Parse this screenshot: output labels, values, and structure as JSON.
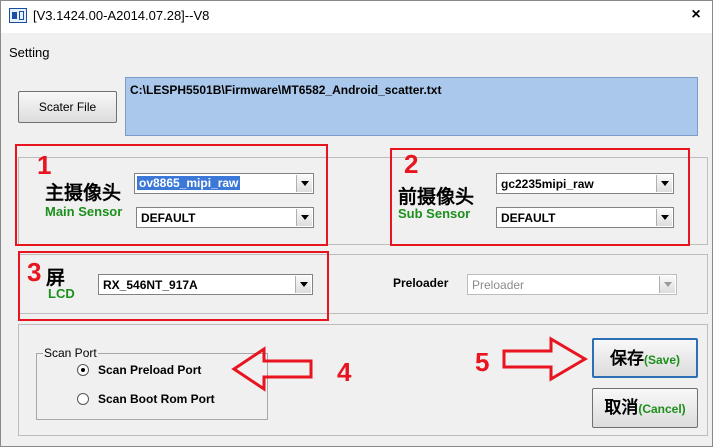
{
  "window": {
    "title": "[V3.1424.00-A2014.07.28]--V8",
    "close_glyph": "×",
    "app_icon": "app-icon"
  },
  "menu": {
    "setting": "Setting"
  },
  "scatter": {
    "button_label": "Scater File",
    "path": "C:\\LESPH5501B\\Firmware\\MT6582_Android_scatter.txt"
  },
  "main_camera": {
    "number": "1",
    "label_cn": "主摄像头",
    "label_en": "Main Sensor",
    "sensor_value": "ov8865_mipi_raw",
    "lens_value": "DEFAULT"
  },
  "sub_camera": {
    "number": "2",
    "label_cn": "前摄像头",
    "label_en": "Sub Sensor",
    "sensor_value": "gc2235mipi_raw",
    "lens_value": "DEFAULT"
  },
  "lcd": {
    "number": "3",
    "label_cn": "屏",
    "label_en": "LCD",
    "value": "RX_546NT_917A"
  },
  "preloader": {
    "label": "Preloader",
    "value": "Preloader"
  },
  "scan_port": {
    "title": "Scan Port",
    "options": [
      {
        "label": "Scan Preload Port",
        "checked": true
      },
      {
        "label": "Scan Boot Rom Port",
        "checked": false
      }
    ],
    "annotation_number": "4"
  },
  "actions": {
    "annotation_number": "5",
    "save_cn": "保存",
    "save_en": "(Save)",
    "cancel_cn": "取消",
    "cancel_en": "(Cancel)"
  },
  "colors": {
    "annotation_red": "#e8141f",
    "sensor_green": "#1c8f1c",
    "path_bg": "#a9c8ec",
    "selection_blue": "#3c78d8"
  }
}
